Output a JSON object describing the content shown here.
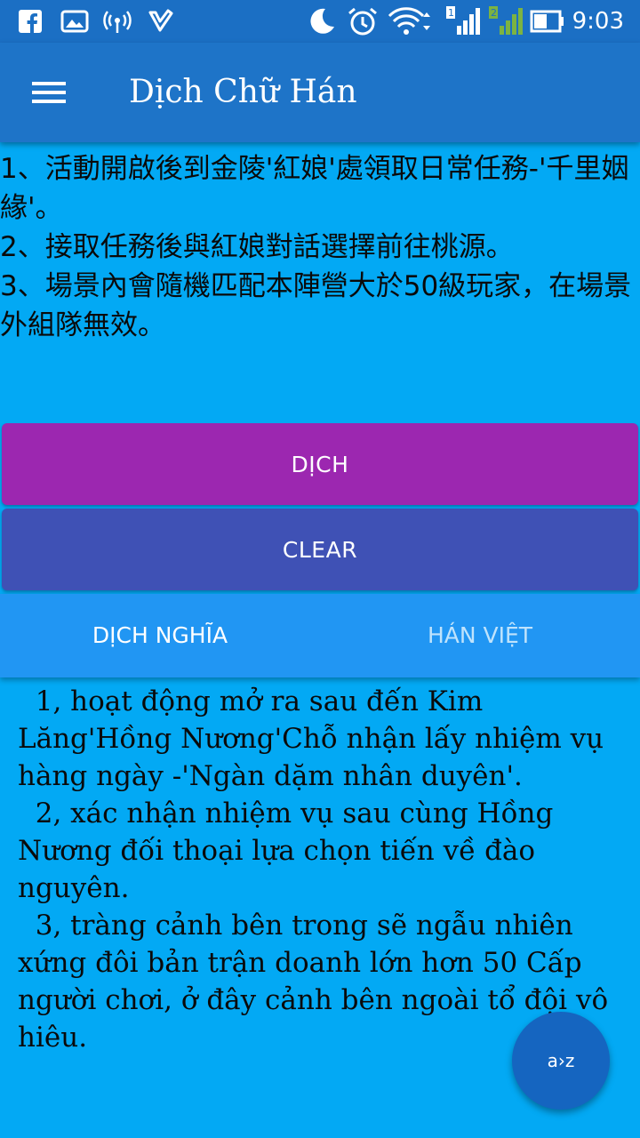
{
  "status_bar": {
    "time": "9:03",
    "icons": [
      "facebook-icon",
      "gallery-icon",
      "hotspot-icon",
      "task-check-icon",
      "moon-icon",
      "alarm-icon",
      "wifi-icon",
      "sim1-signal-icon",
      "sim2-signal-icon",
      "battery-icon"
    ]
  },
  "app_bar": {
    "title": "Dịch Chữ Hán",
    "menu_icon": "hamburger-menu-icon"
  },
  "input": {
    "text": "1、活動開啟後到金陵'紅娘'處領取日常任務-'千里姻緣'。\n2、接取任務後與紅娘對話選擇前往桃源。\n3、場景內會隨機匹配本陣營大於50級玩家，在場景外組隊無效。"
  },
  "buttons": {
    "translate": "DỊCH",
    "clear": "CLEAR"
  },
  "tabs": {
    "meaning": "DỊCH NGHĨA",
    "han_viet": "HÁN VIỆT",
    "selected": "meaning"
  },
  "output": {
    "text": "  1, hoạt động mở ra sau đến Kim Lăng'Hồng Nương'Chỗ nhận lấy nhiệm vụ hàng ngày -'Ngàn dặm nhân duyên'.\n  2, xác nhận nhiệm vụ sau cùng Hồng Nương đối thoại lựa chọn tiến về đào nguyên.\n  3, tràng cảnh bên trong sẽ ngẫu nhiên xứng đôi bản trận doanh lớn hơn 50 Cấp người chơi, ở đây cảnh bên ngoài tổ đội vô hiêu."
  },
  "fab": {
    "label": "a›z",
    "icon": "translate-az-icon"
  },
  "colors": {
    "background": "#03a9f4",
    "status_bar": "#1b6fc4",
    "app_bar": "#1e74c8",
    "translate_button": "#9c27b0",
    "clear_button": "#3f51b5",
    "tabs": "#2196f3",
    "fab": "#1565c0"
  }
}
